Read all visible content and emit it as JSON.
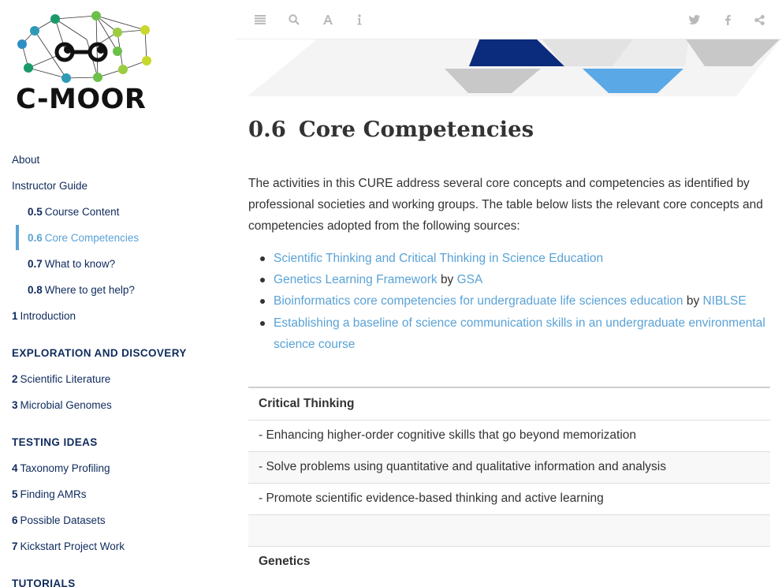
{
  "sidebar": {
    "logo_text": "C-MOOR",
    "nav": [
      {
        "kind": "item",
        "level": 1,
        "num": "",
        "label": "About",
        "active": false
      },
      {
        "kind": "item",
        "level": 1,
        "num": "",
        "label": "Instructor Guide",
        "active": false
      },
      {
        "kind": "item",
        "level": 2,
        "num": "0.5",
        "label": "Course Content",
        "active": false
      },
      {
        "kind": "item",
        "level": 2,
        "num": "0.6",
        "label": "Core Competencies",
        "active": true
      },
      {
        "kind": "item",
        "level": 2,
        "num": "0.7",
        "label": "What to know?",
        "active": false
      },
      {
        "kind": "item",
        "level": 2,
        "num": "0.8",
        "label": "Where to get help?",
        "active": false
      },
      {
        "kind": "item",
        "level": 1,
        "num": "1",
        "label": "Introduction",
        "active": false
      },
      {
        "kind": "header",
        "label": "EXPLORATION AND DISCOVERY"
      },
      {
        "kind": "item",
        "level": 1,
        "num": "2",
        "label": "Scientific Literature",
        "active": false
      },
      {
        "kind": "item",
        "level": 1,
        "num": "3",
        "label": "Microbial Genomes",
        "active": false
      },
      {
        "kind": "header",
        "label": "TESTING IDEAS"
      },
      {
        "kind": "item",
        "level": 1,
        "num": "4",
        "label": "Taxonomy Profiling",
        "active": false
      },
      {
        "kind": "item",
        "level": 1,
        "num": "5",
        "label": "Finding AMRs",
        "active": false
      },
      {
        "kind": "item",
        "level": 1,
        "num": "6",
        "label": "Possible Datasets",
        "active": false
      },
      {
        "kind": "item",
        "level": 1,
        "num": "7",
        "label": "Kickstart Project Work",
        "active": false
      },
      {
        "kind": "header",
        "label": "TUTORIALS"
      }
    ]
  },
  "toolbar": {
    "left_buttons": [
      "menu-icon",
      "search-icon",
      "font-icon",
      "info-icon"
    ],
    "right_buttons": [
      "twitter-icon",
      "facebook-icon",
      "share-icon"
    ],
    "icon_color": "#b9b9b9"
  },
  "main": {
    "section_number": "0.6",
    "title": "Core Competencies",
    "intro": "The activities in this CURE address several core concepts and competencies as identified by professional societies and working groups. The table below lists the relevant core concepts and competencies adopted from the following sources:",
    "sources": [
      {
        "link": "Scientific Thinking and Critical Thinking in Science Education",
        "by": "",
        "org": ""
      },
      {
        "link": "Genetics Learning Framework",
        "by": "by",
        "org": "GSA"
      },
      {
        "link": "Bioinformatics core competencies for undergraduate life sciences education",
        "by": "by",
        "org": "NIBLSE"
      },
      {
        "link": "Establishing a baseline of science communication skills in an undergraduate environmental science course",
        "by": "",
        "org": ""
      }
    ],
    "table": {
      "rows": [
        {
          "text": "Critical Thinking",
          "header": true
        },
        {
          "text": "- Enhancing higher-order cognitive skills that go beyond memorization",
          "header": false
        },
        {
          "text": "- Solve problems using quantitative and qualitative information and analysis",
          "header": false
        },
        {
          "text": "- Promote scientific evidence-based thinking and active learning",
          "header": false
        },
        {
          "text": "",
          "header": false
        },
        {
          "text": "Genetics",
          "header": true
        }
      ]
    }
  },
  "colors": {
    "nav_text": "#0f2a5c",
    "link": "#5aa2d6",
    "banner_dark": "#0b2b7c",
    "banner_light_blue": "#5aa8e6",
    "banner_grey": "#c8c8c8"
  }
}
